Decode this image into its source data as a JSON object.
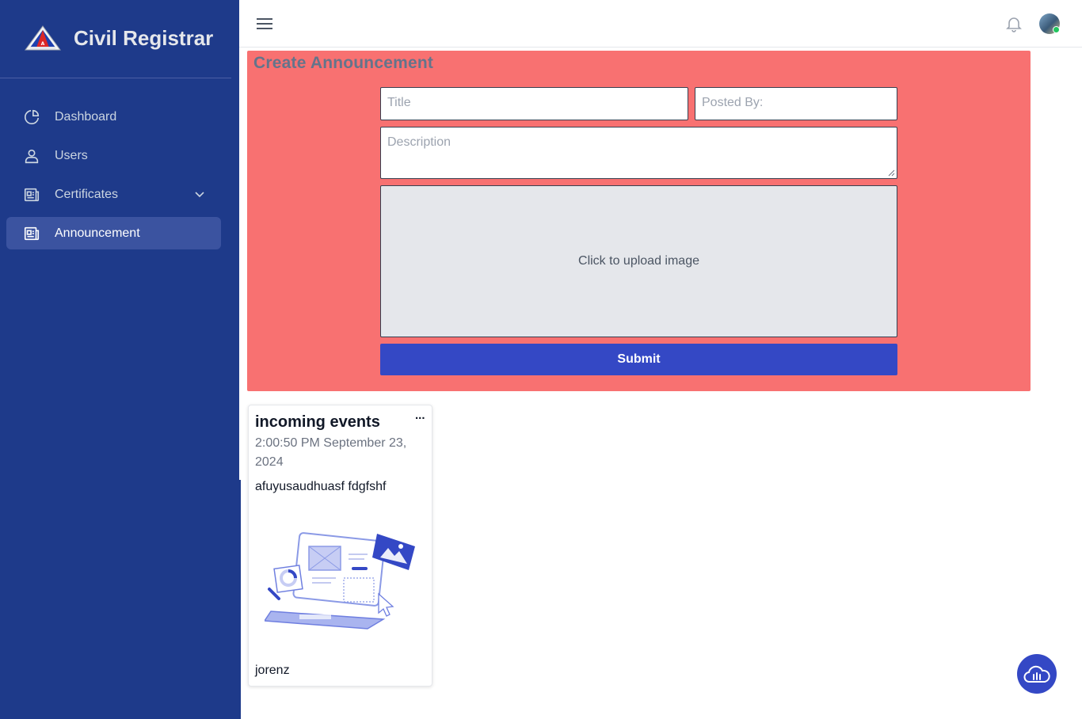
{
  "brand": {
    "name": "Civil Registrar",
    "logo_icon": "triangle-seal-logo"
  },
  "sidebar": {
    "items": [
      {
        "label": "Dashboard",
        "icon": "pie-chart-icon",
        "active": false
      },
      {
        "label": "Users",
        "icon": "user-icon",
        "active": false
      },
      {
        "label": "Certificates",
        "icon": "document-icon",
        "active": false,
        "expandable": true
      },
      {
        "label": "Announcement",
        "icon": "newspaper-icon",
        "active": true
      }
    ]
  },
  "topbar": {
    "menu_icon": "hamburger-icon",
    "bell_icon": "bell-icon",
    "avatar_status": "online"
  },
  "create": {
    "title": "Create Announcement",
    "title_placeholder": "Title",
    "posted_by_placeholder": "Posted By:",
    "description_placeholder": "Description",
    "upload_label": "Click to upload image",
    "submit_label": "Submit"
  },
  "announcements": [
    {
      "title": "incoming events",
      "menu": "...",
      "date": "2:00:50 PM September 23, 2024",
      "description": "afuyusaudhuasf fdgfshf",
      "author": "jorenz"
    }
  ],
  "colors": {
    "sidebar": "#1e3a8a",
    "active_item": "#3b53a0",
    "panel": "#f87171",
    "submit": "#3448c5",
    "upload_bg": "#e5e7eb"
  }
}
